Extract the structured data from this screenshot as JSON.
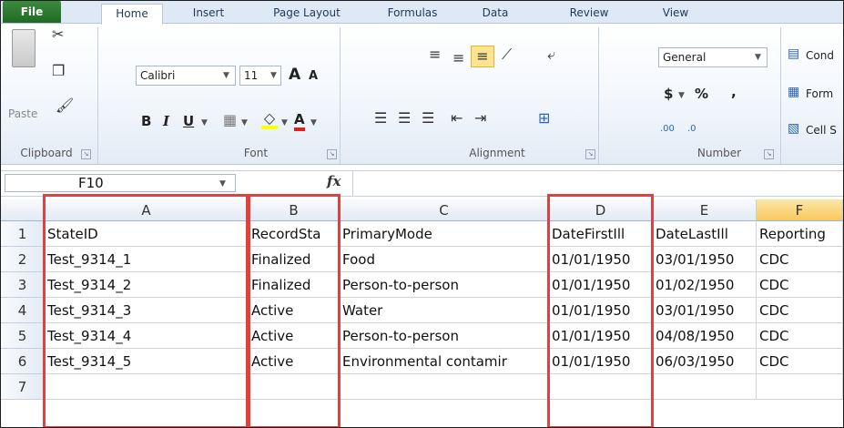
{
  "tabs": {
    "file": "File",
    "home": "Home",
    "insert": "Insert",
    "page_layout": "Page Layout",
    "formulas": "Formulas",
    "data": "Data",
    "review": "Review",
    "view": "View"
  },
  "ribbon": {
    "clipboard": {
      "label": "Clipboard",
      "paste": "Paste"
    },
    "font": {
      "label": "Font",
      "name": "Calibri",
      "size": "11",
      "bold": "B",
      "italic": "I",
      "underline": "U",
      "grow": "A",
      "shrink": "A",
      "color_a": "A"
    },
    "alignment": {
      "label": "Alignment"
    },
    "number": {
      "label": "Number",
      "format": "General",
      "currency": "$",
      "percent": "%",
      "comma": ",",
      "inc_decimal": ".00",
      "dec_decimal": ".0"
    },
    "styles": {
      "conditional": "Cond",
      "format_table": "Form",
      "cell_styles": "Cell S"
    }
  },
  "formula_bar": {
    "name_box": "F10",
    "fx": "fx",
    "value": ""
  },
  "grid": {
    "columns": [
      "A",
      "B",
      "C",
      "D",
      "E",
      "F"
    ],
    "rows": [
      "1",
      "2",
      "3",
      "4",
      "5",
      "6",
      "7"
    ],
    "cells": [
      [
        "StateID",
        "RecordSta",
        "PrimaryMode",
        "DateFirstIll",
        "DateLastIll",
        "Reporting"
      ],
      [
        "Test_9314_1",
        "Finalized",
        "Food",
        "01/01/1950",
        "03/01/1950",
        "CDC"
      ],
      [
        "Test_9314_2",
        "Finalized",
        "Person-to-person",
        "01/01/1950",
        "01/02/1950",
        "CDC"
      ],
      [
        "Test_9314_3",
        "Active",
        "Water",
        "01/01/1950",
        "03/01/1950",
        "CDC"
      ],
      [
        "Test_9314_4",
        "Active",
        "Person-to-person",
        "01/01/1950",
        "04/08/1950",
        "CDC"
      ],
      [
        "Test_9314_5",
        "Active",
        "Environmental contamir",
        "01/01/1950",
        "06/03/1950",
        "CDC"
      ],
      [
        "",
        "",
        "",
        "",
        "",
        ""
      ]
    ]
  },
  "colors": {
    "highlight": "#e0413f",
    "selected_column_header": "#f7c95e",
    "file_tab": "#2e7d32"
  }
}
